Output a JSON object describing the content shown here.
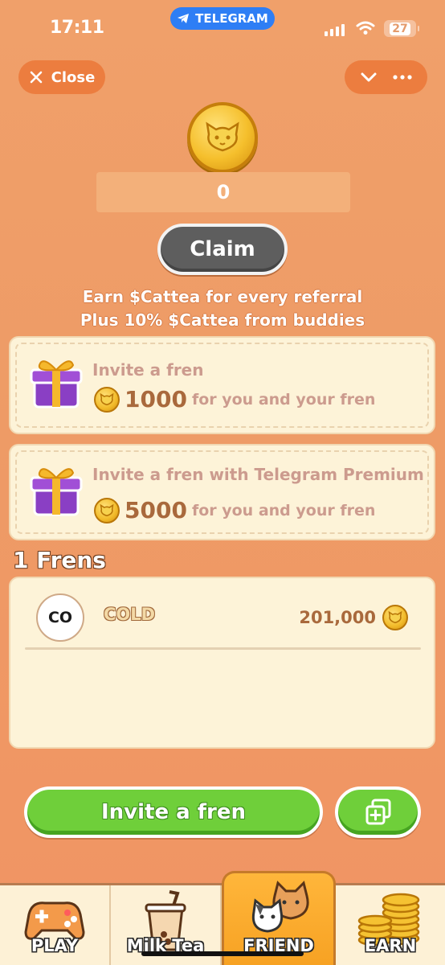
{
  "status_bar": {
    "time": "17:11",
    "app_badge": "TELEGRAM",
    "battery": "27"
  },
  "header": {
    "close_label": "Close"
  },
  "balance": {
    "value": "0",
    "claim_label": "Claim"
  },
  "promo": {
    "line1": "Earn $Cattea for every referral",
    "line2": "Plus 10% $Cattea from buddies"
  },
  "invite_cards": [
    {
      "title": "Invite a fren",
      "amount": "1000",
      "suffix": "for you and your fren"
    },
    {
      "title": "Invite a fren with Telegram Premium",
      "amount": "5000",
      "suffix": "for you and your fren"
    }
  ],
  "frens": {
    "title": "1 Frens",
    "list": [
      {
        "avatar": "CO",
        "name": "COLD",
        "amount": "201,000"
      }
    ]
  },
  "actions": {
    "invite_label": "Invite a fren"
  },
  "nav": [
    {
      "label": "PLAY",
      "icon": "gamepad-icon",
      "active": false
    },
    {
      "label": "Milk Tea",
      "icon": "bubble-tea-icon",
      "active": false
    },
    {
      "label": "FRIEND",
      "icon": "cats-icon",
      "active": true
    },
    {
      "label": "EARN",
      "icon": "coin-stack-icon",
      "active": false
    }
  ],
  "colors": {
    "background": "#ef9c66",
    "accent_orange": "#ec7d3f",
    "green": "#6fcf3a",
    "card": "#fdf3d8",
    "telegram_blue": "#2e7ef5"
  }
}
